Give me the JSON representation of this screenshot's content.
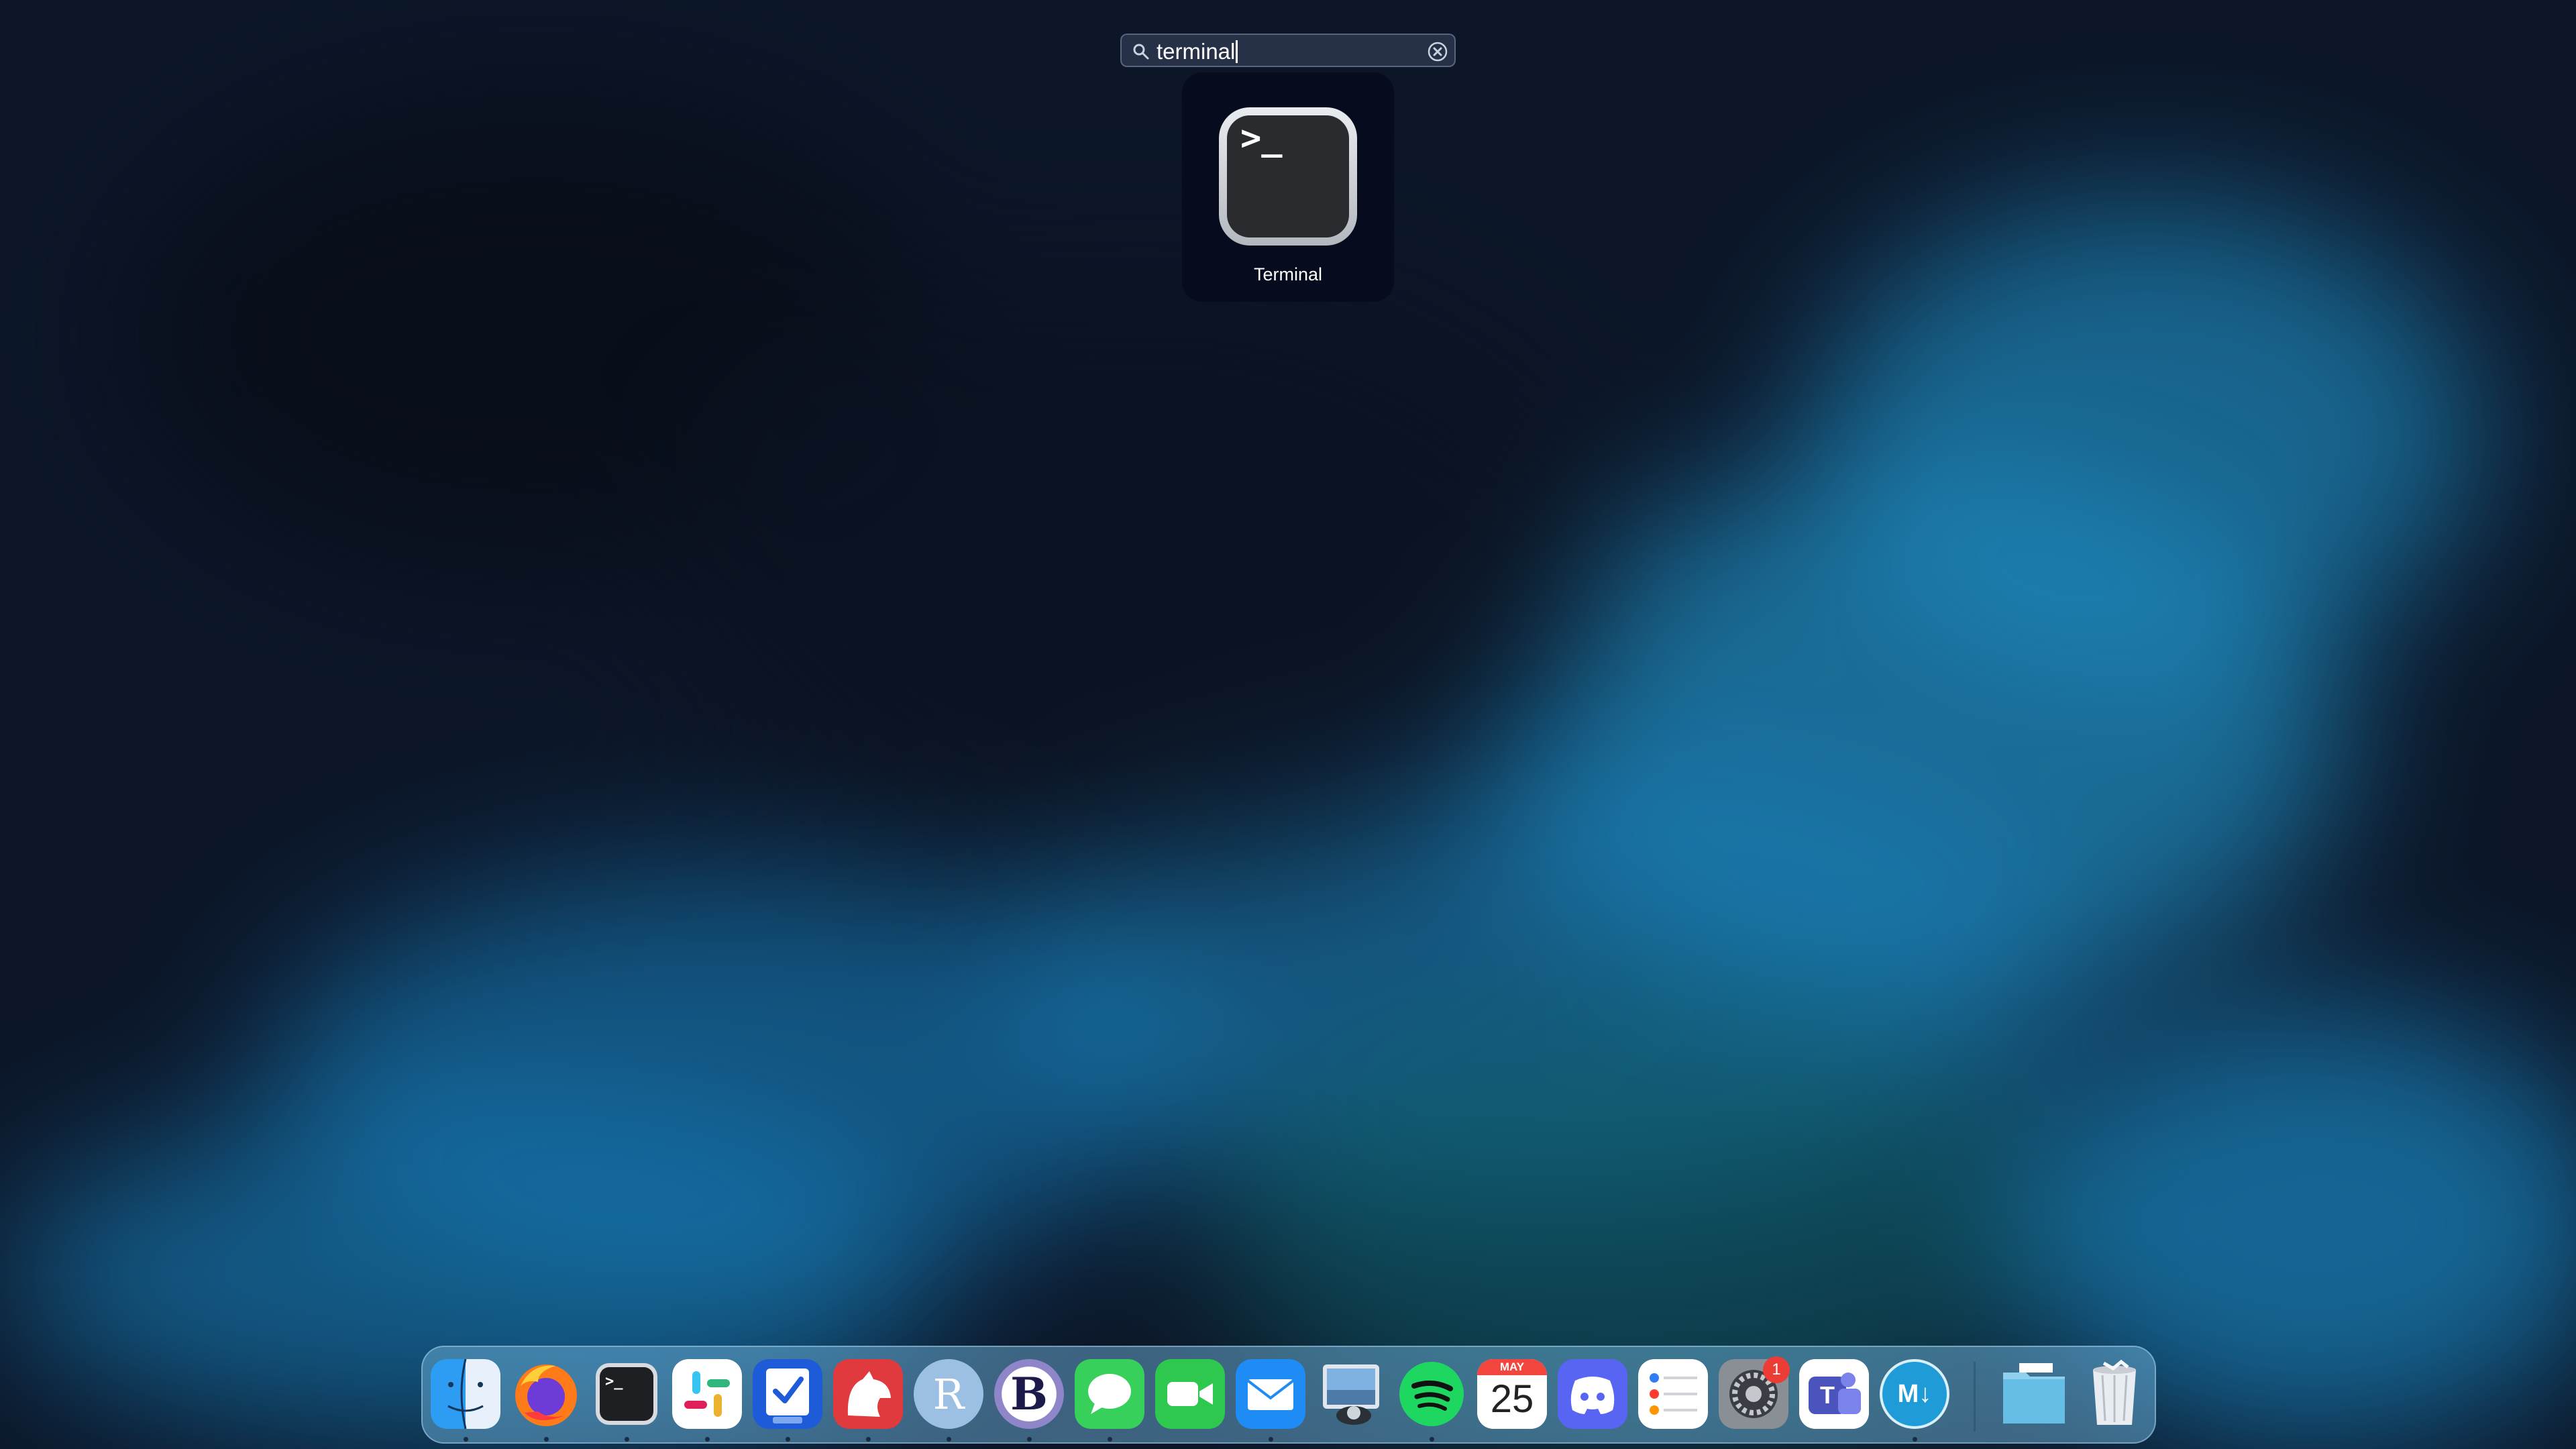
{
  "search": {
    "query": "terminal"
  },
  "results": [
    {
      "name": "Terminal",
      "icon": "terminal-icon"
    }
  ],
  "dock": {
    "apps": [
      {
        "name": "Finder",
        "icon": "finder-icon",
        "running": true
      },
      {
        "name": "Firefox",
        "icon": "firefox-icon",
        "running": true
      },
      {
        "name": "Terminal",
        "icon": "terminal-icon",
        "running": true
      },
      {
        "name": "Slack",
        "icon": "slack-icon",
        "running": true
      },
      {
        "name": "Task Manager",
        "icon": "checklist-icon",
        "running": true
      },
      {
        "name": "Bear",
        "icon": "bear-icon",
        "running": true
      },
      {
        "name": "R",
        "icon": "r-icon",
        "glyph": "R",
        "running": true
      },
      {
        "name": "BBEdit",
        "icon": "bbedit-icon",
        "glyph": "B",
        "running": true
      },
      {
        "name": "Messages",
        "icon": "messages-icon",
        "running": true
      },
      {
        "name": "FaceTime",
        "icon": "facetime-icon",
        "running": false
      },
      {
        "name": "Mail",
        "icon": "mail-icon",
        "running": true
      },
      {
        "name": "Preview",
        "icon": "preview-icon",
        "running": false
      },
      {
        "name": "Spotify",
        "icon": "spotify-icon",
        "running": true
      },
      {
        "name": "Calendar",
        "icon": "calendar-icon",
        "month": "MAY",
        "day": "25",
        "running": false
      },
      {
        "name": "Discord",
        "icon": "discord-icon",
        "running": false
      },
      {
        "name": "Reminders",
        "icon": "reminders-icon",
        "running": false
      },
      {
        "name": "System Settings",
        "icon": "settings-icon",
        "badge": "1",
        "running": false
      },
      {
        "name": "Microsoft Teams",
        "icon": "teams-icon",
        "glyph": "T",
        "running": false
      },
      {
        "name": "Markdown",
        "icon": "markdown-icon",
        "glyph": "M↓",
        "running": true
      }
    ],
    "stack": [
      {
        "name": "Folder",
        "icon": "folder-icon"
      },
      {
        "name": "Trash",
        "icon": "trash-icon"
      }
    ]
  },
  "colors": {
    "wallpaper_dark": "#0c1628",
    "wallpaper_accent": "#1a8fc9",
    "dock_tint": "#7ab8d9",
    "badge_red": "#ec3c36"
  }
}
